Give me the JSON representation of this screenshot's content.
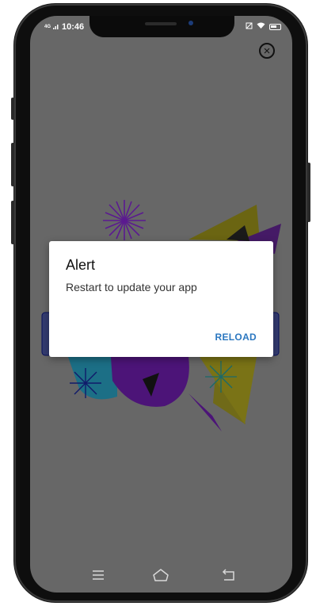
{
  "status_bar": {
    "time": "10:46",
    "network": "4G"
  },
  "dialog": {
    "title": "Alert",
    "message": "Restart to update your app",
    "action_label": "RELOAD",
    "action_color": "#2b77c0"
  },
  "icons": {
    "close": "close-circle-icon",
    "nav_menu": "menu-icon",
    "nav_home": "home-icon",
    "nav_back": "back-icon"
  },
  "colors": {
    "overlay_background": "#676767",
    "banner_blue": "#0b1a7a",
    "art_yellow": "#c8b400",
    "art_purple": "#6a1aa0",
    "art_teal": "#1c93b0"
  }
}
